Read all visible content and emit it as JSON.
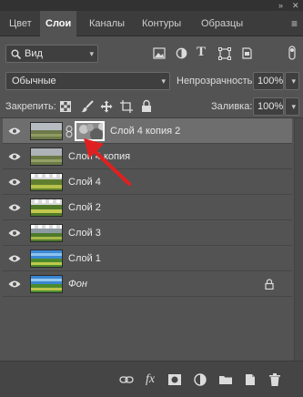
{
  "tabs": [
    {
      "label": "Цвет"
    },
    {
      "label": "Слои"
    },
    {
      "label": "Каналы"
    },
    {
      "label": "Контуры"
    },
    {
      "label": "Образцы"
    }
  ],
  "filter": {
    "label": "Вид"
  },
  "blend_mode": {
    "value": "Обычные"
  },
  "opacity": {
    "label": "Непрозрачность:",
    "value": "100%"
  },
  "lock": {
    "label": "Закрепить:"
  },
  "fill": {
    "label": "Заливка:",
    "value": "100%"
  },
  "layers": [
    {
      "name": "Слой 4 копия 2",
      "selected": true,
      "has_mask": true
    },
    {
      "name": "Слой 4 копия",
      "selected": false
    },
    {
      "name": "Слой 4",
      "selected": false
    },
    {
      "name": "Слой 2",
      "selected": false
    },
    {
      "name": "Слой 3",
      "selected": false
    },
    {
      "name": "Слой 1",
      "selected": false
    },
    {
      "name": "Фон",
      "selected": false,
      "locked": true
    }
  ],
  "bottom_icons": [
    "link-icon",
    "fx-icon",
    "mask-icon",
    "adjustment-icon",
    "group-icon",
    "new-layer-icon",
    "trash-icon"
  ],
  "colors": {
    "panel": "#535353",
    "selected_row": "#6e6e6e",
    "annotation_arrow": "#e02020"
  }
}
